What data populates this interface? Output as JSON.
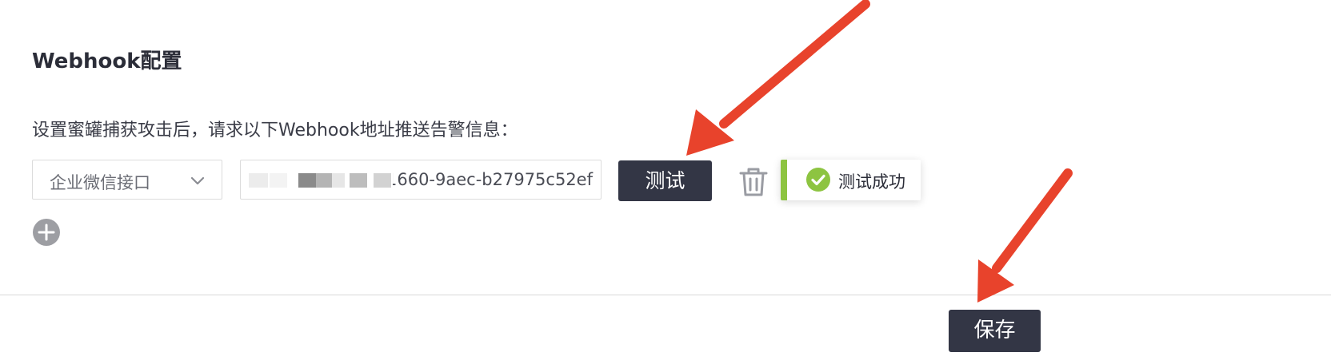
{
  "section": {
    "title": "Webhook配置",
    "description": "设置蜜罐捕获攻击后，请求以下Webhook地址推送告警信息："
  },
  "webhook_row": {
    "type_select": {
      "selected": "企业微信接口",
      "icon": "chevron-down-icon"
    },
    "url_input": {
      "value_visible": "1660-9aec-b27975c52ef"
    },
    "test_button_label": "测试",
    "delete_icon": "trash-icon",
    "toast": {
      "icon": "check-circle-icon",
      "message": "测试成功",
      "accent_color": "#8dc441"
    }
  },
  "add_icon": "plus-circle-icon",
  "footer": {
    "save_label": "保存"
  },
  "colors": {
    "button_bg": "#333645",
    "annotation_arrow": "#e8432c",
    "success": "#8dc441"
  }
}
